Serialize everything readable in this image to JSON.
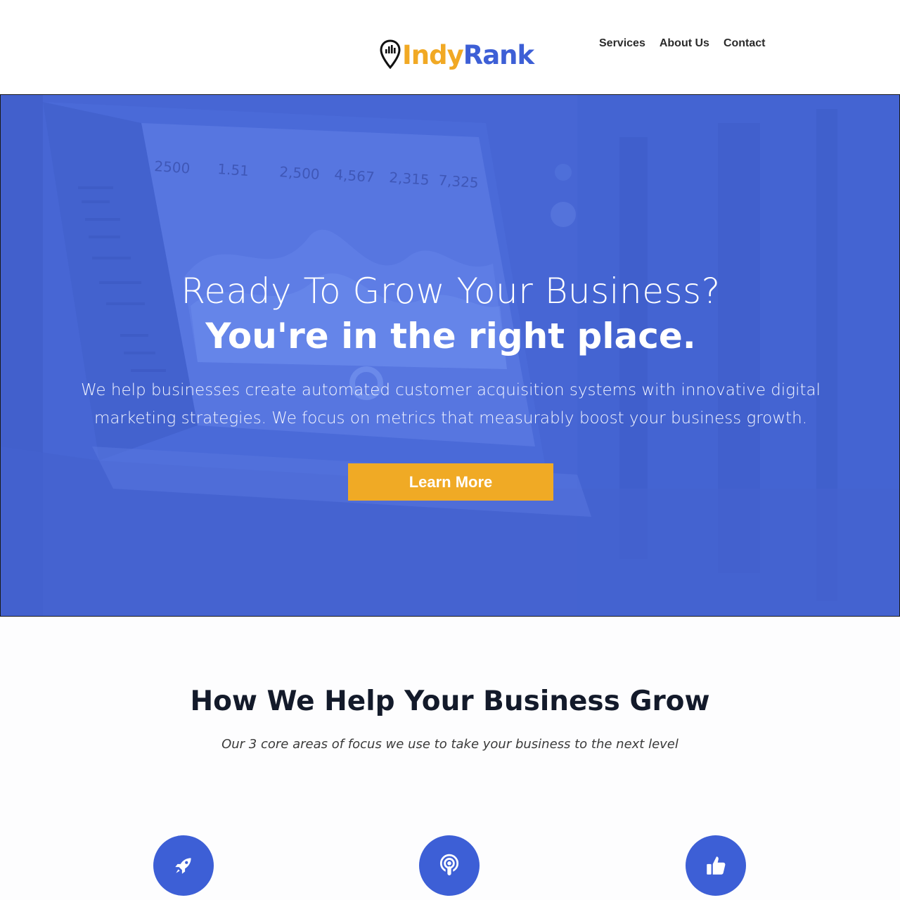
{
  "header": {
    "logo": {
      "part1": "Indy",
      "part2": "Rank"
    },
    "nav": [
      {
        "label": "Services"
      },
      {
        "label": "About Us"
      },
      {
        "label": "Contact"
      }
    ]
  },
  "hero": {
    "headline_light": "Ready To Grow Your Business?",
    "headline_bold": "You're in the right place.",
    "description": "We help businesses create automated customer acquisition systems with innovative digital marketing strategies.  We focus on metrics that measurably boost your business growth.",
    "cta_label": "Learn More",
    "background_metrics": [
      "2500",
      "1.51",
      "2,500",
      "4,567",
      "2,315",
      "7,325"
    ]
  },
  "section": {
    "title": "How We Help Your Business Grow",
    "subtitle": "Our 3 core areas of focus we use to take your business to the next level",
    "features": [
      {
        "icon": "rocket-icon"
      },
      {
        "icon": "podcast-icon"
      },
      {
        "icon": "thumbs-up-icon"
      }
    ]
  },
  "colors": {
    "brand_blue": "#3d5fd6",
    "brand_orange": "#f1a924",
    "hero_overlay": "#4766d4"
  }
}
